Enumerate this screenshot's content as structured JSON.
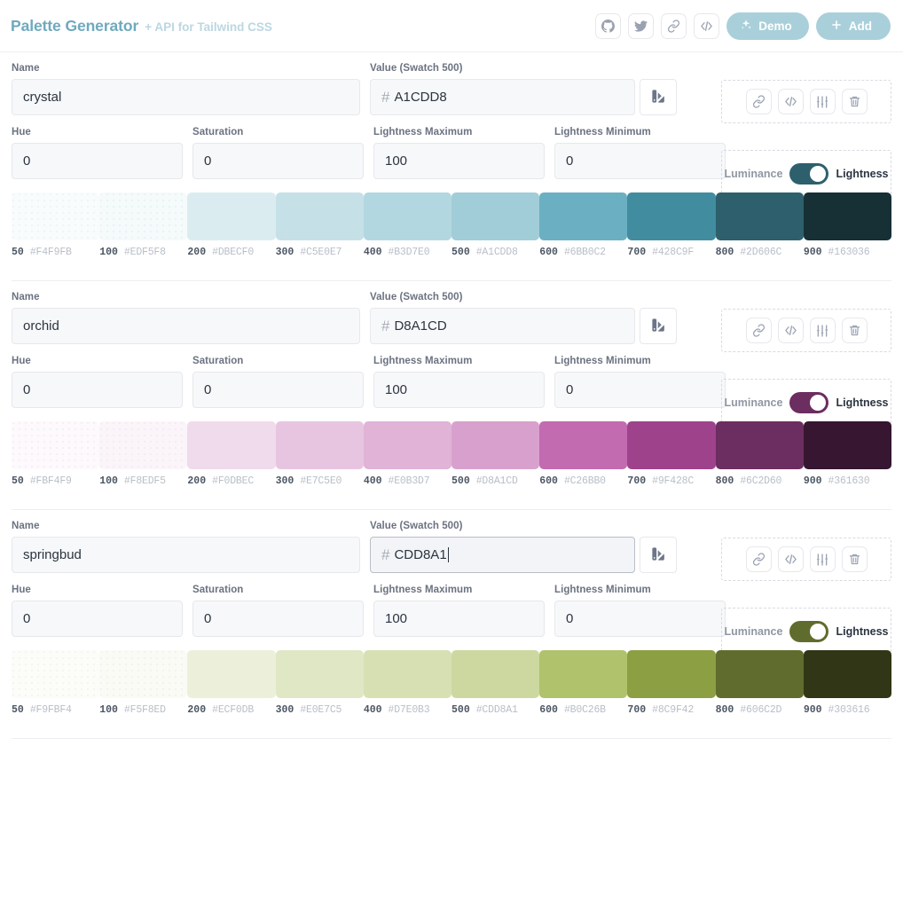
{
  "header": {
    "title": "Palette Generator",
    "subtitle": "+ API for Tailwind CSS",
    "icon_buttons": [
      {
        "name": "github-icon",
        "label": "GitHub"
      },
      {
        "name": "twitter-icon",
        "label": "Twitter"
      },
      {
        "name": "link-icon",
        "label": "Share link"
      },
      {
        "name": "code-icon",
        "label": "Code"
      }
    ],
    "demo_label": "Demo",
    "add_label": "Add",
    "accent": "#a9d0da",
    "title_color": "#6fa9bd",
    "subtitle_color": "#bcd7e1"
  },
  "labels": {
    "name": "Name",
    "value": "Value (Swatch 500)",
    "hue": "Hue",
    "saturation": "Saturation",
    "lightness_max": "Lightness Maximum",
    "lightness_min": "Lightness Minimum",
    "luminance": "Luminance",
    "lightness": "Lightness",
    "hash": "#"
  },
  "row_actions": [
    {
      "name": "copy-link-button",
      "label": "Copy link"
    },
    {
      "name": "code-button",
      "label": "Code"
    },
    {
      "name": "sliders-button",
      "label": "Adjust"
    },
    {
      "name": "delete-button",
      "label": "Delete"
    }
  ],
  "palettes": [
    {
      "name": "crystal",
      "value": "A1CDD8",
      "focused": false,
      "hue": "0",
      "saturation": "0",
      "lightness_max": "100",
      "lightness_min": "0",
      "toggle_on": true,
      "toggle_color": "#2D606C",
      "swatches": [
        {
          "step": "50",
          "hex": "#F4F9FB"
        },
        {
          "step": "100",
          "hex": "#EDF5F8"
        },
        {
          "step": "200",
          "hex": "#DBECF0"
        },
        {
          "step": "300",
          "hex": "#C5E0E7"
        },
        {
          "step": "400",
          "hex": "#B3D7E0"
        },
        {
          "step": "500",
          "hex": "#A1CDD8"
        },
        {
          "step": "600",
          "hex": "#6BB0C2"
        },
        {
          "step": "700",
          "hex": "#428C9F"
        },
        {
          "step": "800",
          "hex": "#2D606C"
        },
        {
          "step": "900",
          "hex": "#163036"
        }
      ]
    },
    {
      "name": "orchid",
      "value": "D8A1CD",
      "focused": false,
      "hue": "0",
      "saturation": "0",
      "lightness_max": "100",
      "lightness_min": "0",
      "toggle_on": true,
      "toggle_color": "#6C2D60",
      "swatches": [
        {
          "step": "50",
          "hex": "#FBF4F9"
        },
        {
          "step": "100",
          "hex": "#F8EDF5"
        },
        {
          "step": "200",
          "hex": "#F0DBEC"
        },
        {
          "step": "300",
          "hex": "#E7C5E0"
        },
        {
          "step": "400",
          "hex": "#E0B3D7"
        },
        {
          "step": "500",
          "hex": "#D8A1CD"
        },
        {
          "step": "600",
          "hex": "#C26BB0"
        },
        {
          "step": "700",
          "hex": "#9F428C"
        },
        {
          "step": "800",
          "hex": "#6C2D60"
        },
        {
          "step": "900",
          "hex": "#361630"
        }
      ]
    },
    {
      "name": "springbud",
      "value": "CDD8A1",
      "focused": true,
      "hue": "0",
      "saturation": "0",
      "lightness_max": "100",
      "lightness_min": "0",
      "toggle_on": true,
      "toggle_color": "#606C2D",
      "swatches": [
        {
          "step": "50",
          "hex": "#F9FBF4"
        },
        {
          "step": "100",
          "hex": "#F5F8ED"
        },
        {
          "step": "200",
          "hex": "#ECF0DB"
        },
        {
          "step": "300",
          "hex": "#E0E7C5"
        },
        {
          "step": "400",
          "hex": "#D7E0B3"
        },
        {
          "step": "500",
          "hex": "#CDD8A1"
        },
        {
          "step": "600",
          "hex": "#B0C26B"
        },
        {
          "step": "700",
          "hex": "#8C9F42"
        },
        {
          "step": "800",
          "hex": "#606C2D"
        },
        {
          "step": "900",
          "hex": "#303616"
        }
      ]
    }
  ]
}
